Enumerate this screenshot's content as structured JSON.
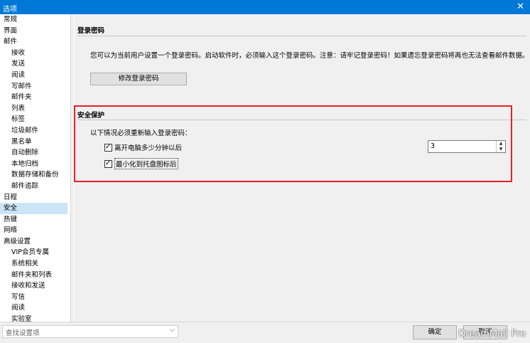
{
  "window": {
    "title": "选项",
    "close": "✕"
  },
  "nav": {
    "items": [
      {
        "label": "常规",
        "level": 1
      },
      {
        "label": "界面",
        "level": 1
      },
      {
        "label": "邮件",
        "level": 1
      },
      {
        "label": "接收",
        "level": 2
      },
      {
        "label": "发送",
        "level": 2
      },
      {
        "label": "阅读",
        "level": 2
      },
      {
        "label": "写邮件",
        "level": 2
      },
      {
        "label": "邮件夹",
        "level": 2
      },
      {
        "label": "列表",
        "level": 2
      },
      {
        "label": "标签",
        "level": 2
      },
      {
        "label": "垃圾邮件",
        "level": 2
      },
      {
        "label": "黑名单",
        "level": 2
      },
      {
        "label": "自动删除",
        "level": 2
      },
      {
        "label": "本地归档",
        "level": 2
      },
      {
        "label": "数据存储和备份",
        "level": 2
      },
      {
        "label": "邮件追踪",
        "level": 2
      },
      {
        "label": "日程",
        "level": 1
      },
      {
        "label": "安全",
        "level": 1,
        "selected": true
      },
      {
        "label": "热键",
        "level": 1
      },
      {
        "label": "网络",
        "level": 1
      },
      {
        "label": "高级设置",
        "level": 1
      },
      {
        "label": "VIP会员专属",
        "level": 2
      },
      {
        "label": "系统相关",
        "level": 2
      },
      {
        "label": "邮件夹和列表",
        "level": 2
      },
      {
        "label": "接收和发送",
        "level": 2
      },
      {
        "label": "写信",
        "level": 2
      },
      {
        "label": "阅读",
        "level": 2
      },
      {
        "label": "实验室",
        "level": 2
      }
    ]
  },
  "login_password": {
    "title": "登录密码",
    "description": "您可以为当前用户设置一个登录密码。启动软件时，必须输入这个登录密码。注意：请牢记登录密码！如果遗忘登录密码将再也无法查看邮件数据。",
    "button": "修改登录密码"
  },
  "security": {
    "title": "安全保护",
    "intro": "以下情况必须重新输入登录密码：",
    "away_label": "离开电脑多少分钟以后",
    "away_checked": true,
    "away_minutes": "3",
    "minimize_label": "最小化到托盘图标后",
    "minimize_checked": true
  },
  "bottom": {
    "search_placeholder": "查找设置项",
    "ok": "确定",
    "cancel": "取消",
    "watermark": "DreamMail Pro"
  }
}
